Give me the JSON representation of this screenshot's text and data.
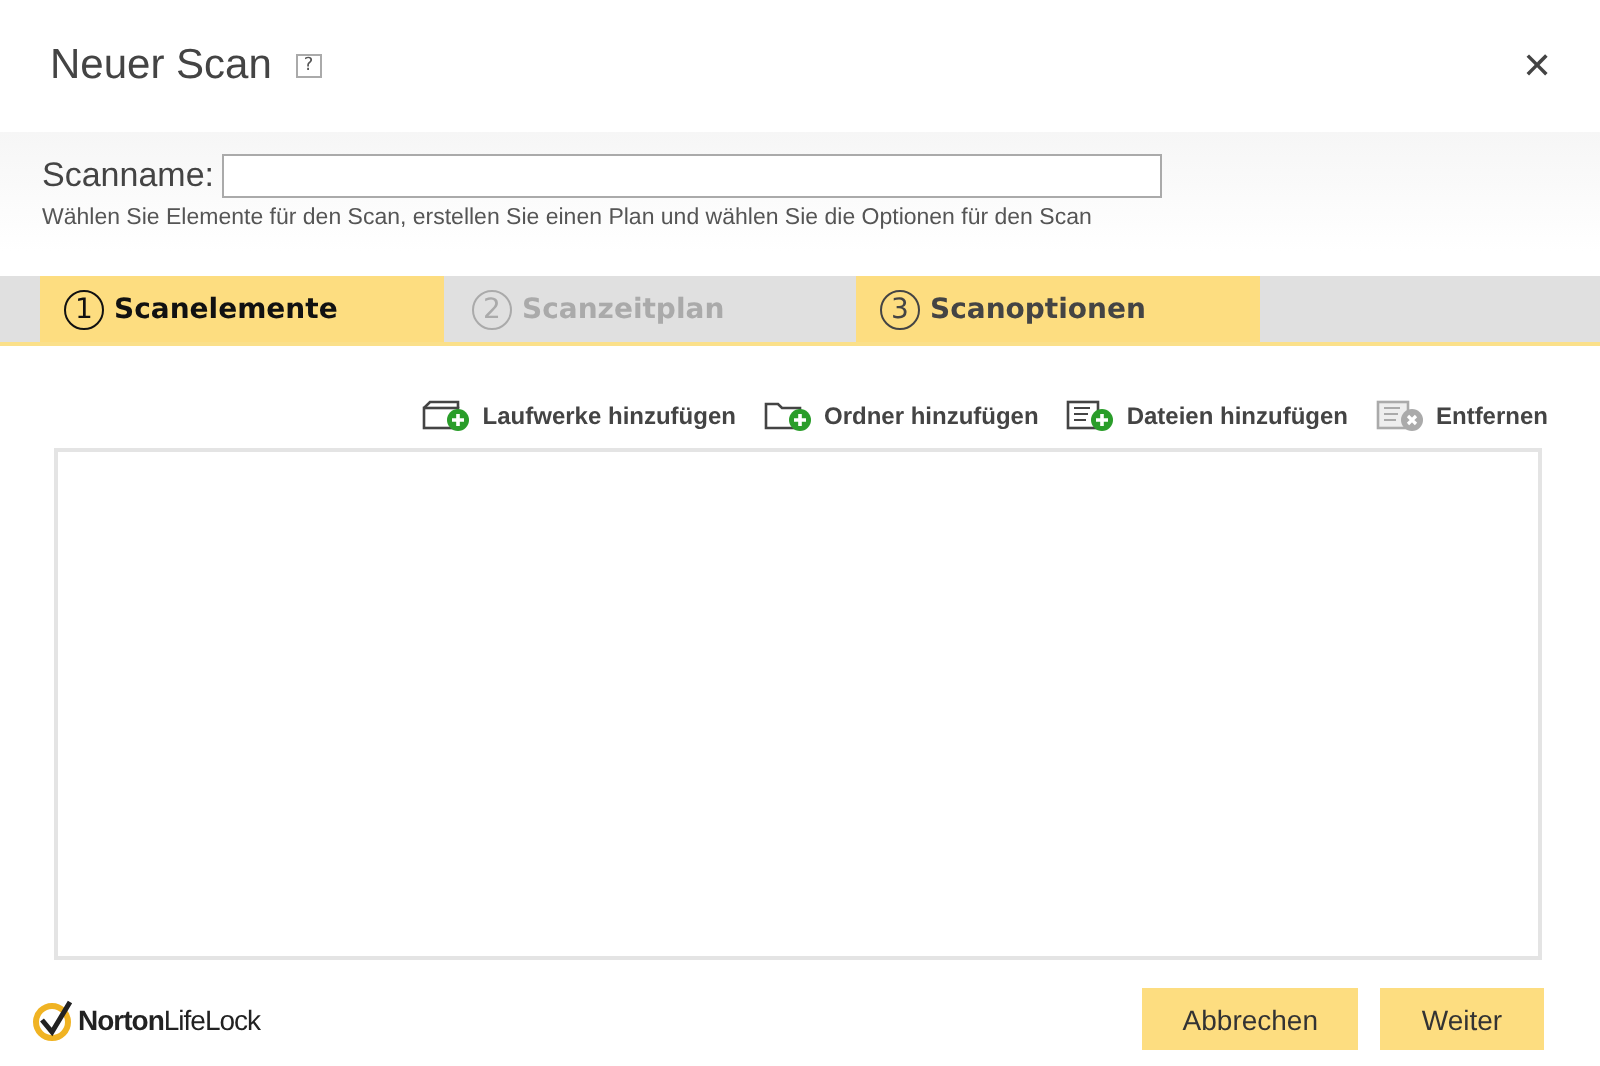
{
  "window": {
    "title": "Neuer Scan",
    "help": "?",
    "close": "✕"
  },
  "scanname": {
    "label": "Scanname:"
  },
  "hint": "Wählen Sie Elemente für den Scan, erstellen Sie einen Plan und wählen Sie die Optionen für den Scan",
  "tabs": [
    {
      "number": "1",
      "label": "Scanelemente",
      "selected": true,
      "disabled": false
    },
    {
      "number": "2",
      "label": "Scanzeitplan",
      "selected": false,
      "disabled": true
    },
    {
      "number": "3",
      "label": "Scanoptionen",
      "selected": false,
      "disabled": false
    }
  ],
  "actions": [
    {
      "kind": "drive",
      "label": "Laufwerke hinzufügen",
      "disabled": false
    },
    {
      "kind": "folder",
      "label": "Ordner hinzufügen",
      "disabled": false
    },
    {
      "kind": "file",
      "label": "Dateien hinzufügen",
      "disabled": false
    },
    {
      "kind": "remove",
      "label": "Entfernen",
      "disabled": true
    }
  ],
  "logo": "**Norton**LifeLock",
  "buttons": [
    "Abbrechen",
    "Weiter"
  ]
}
